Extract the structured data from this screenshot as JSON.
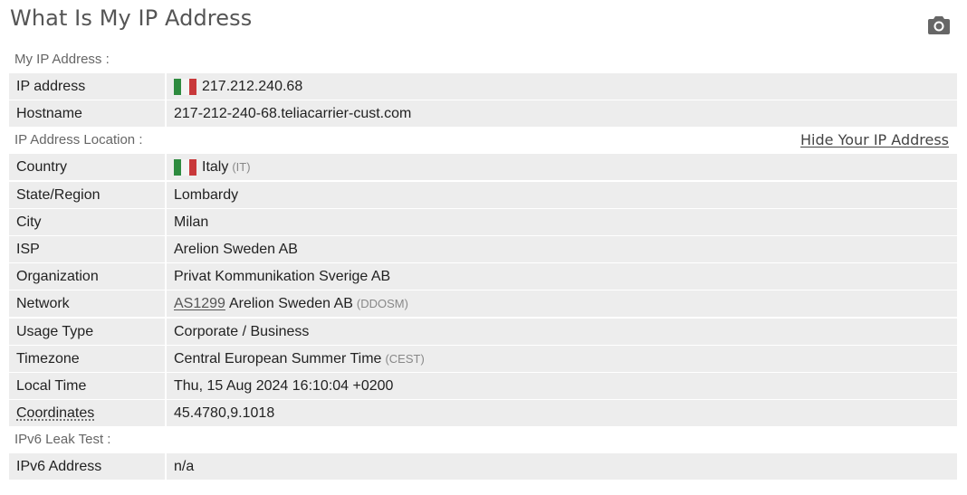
{
  "title": "What Is My IP Address",
  "icons": {
    "camera": "camera-icon",
    "flag": "italy-flag-icon"
  },
  "flag_colors": {
    "green": "#2e8b3f",
    "white": "#f4f4f4",
    "red": "#c8383a"
  },
  "sections": {
    "my_ip": "My IP Address :",
    "location": "IP Address Location :",
    "hide_link": "Hide Your IP Address",
    "ipv6": "IPv6 Leak Test :"
  },
  "ip": {
    "ip_label": "IP address",
    "ip_value": "217.212.240.68",
    "host_label": "Hostname",
    "host_value": "217-212-240-68.teliacarrier-cust.com"
  },
  "location": {
    "country_label": "Country",
    "country_value": "Italy",
    "country_code": "(IT)",
    "state_label": "State/Region",
    "state_value": "Lombardy",
    "city_label": "City",
    "city_value": "Milan",
    "isp_label": "ISP",
    "isp_value": "Arelion Sweden AB",
    "org_label": "Organization",
    "org_value": "Privat Kommunikation Sverige AB",
    "network_label": "Network",
    "network_as": "AS1299",
    "network_value": "Arelion Sweden AB",
    "network_code": "(DDOSM)",
    "usage_label": "Usage Type",
    "usage_value": "Corporate / Business",
    "tz_label": "Timezone",
    "tz_value": "Central European Summer Time",
    "tz_code": "(CEST)",
    "time_label": "Local Time",
    "time_value": "Thu, 15 Aug 2024 16:10:04 +0200",
    "coord_label": "Coordinates",
    "coord_value": "45.4780,9.1018"
  },
  "ipv6": {
    "label": "IPv6 Address",
    "value": "n/a"
  }
}
